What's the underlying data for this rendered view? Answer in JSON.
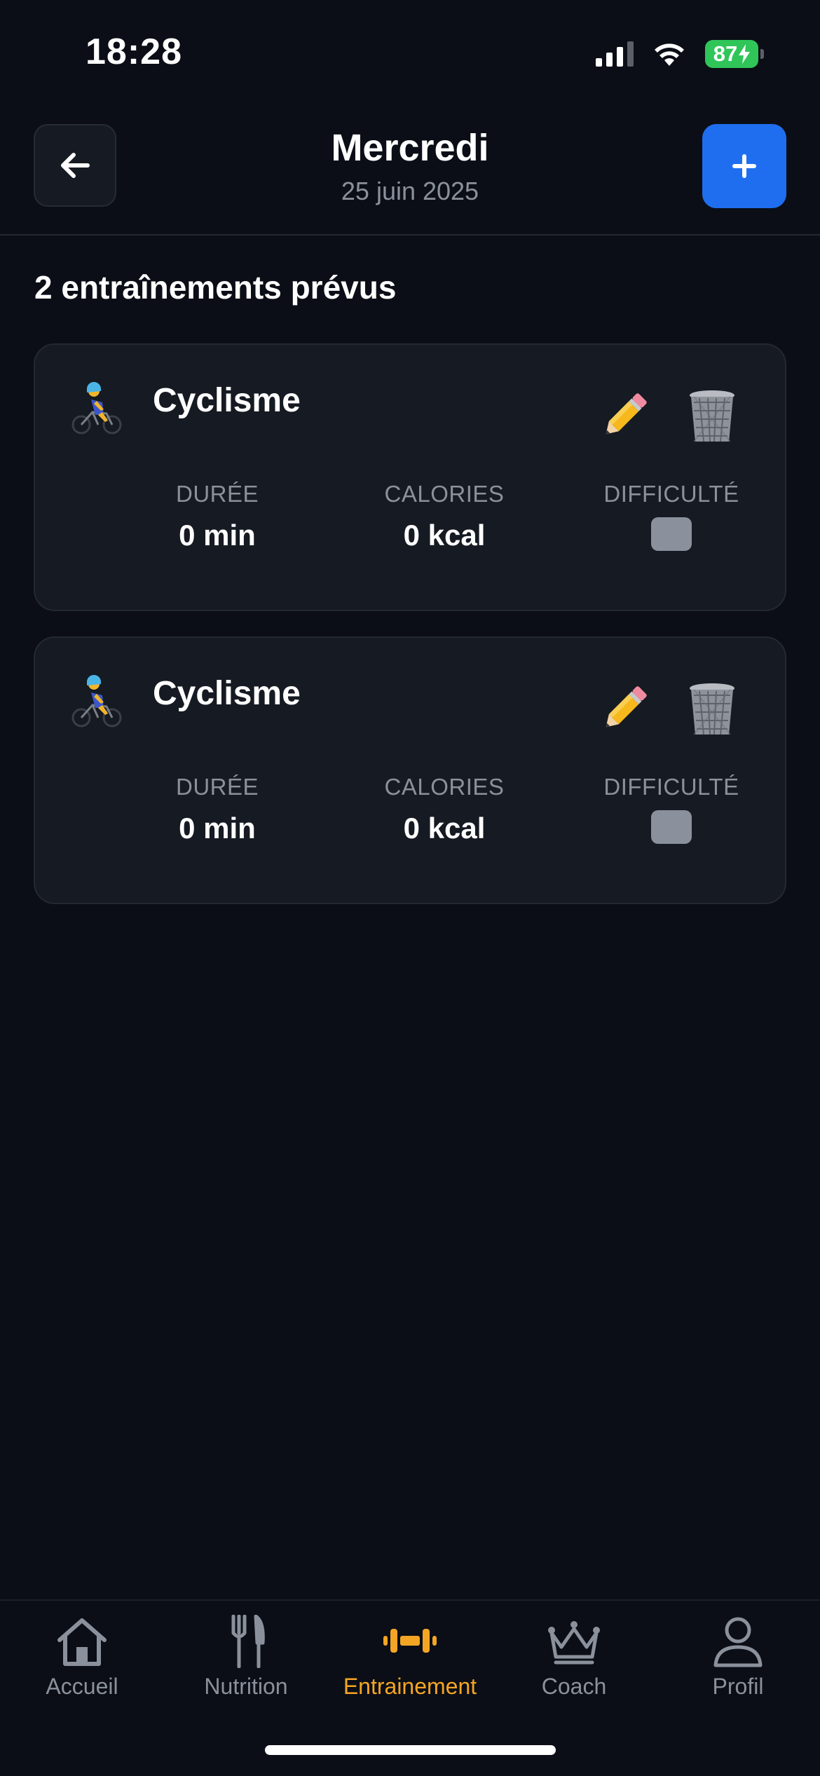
{
  "status_bar": {
    "time": "18:28",
    "battery": "87"
  },
  "header": {
    "title": "Mercredi",
    "subtitle": "25 juin 2025",
    "back_icon": "arrow-left-icon",
    "add_icon": "plus-icon"
  },
  "section": {
    "title": "2 entraînements prévus"
  },
  "workouts": [
    {
      "name": "Cyclisme",
      "icon": "cyclist-icon",
      "stats": [
        {
          "label": "DURÉE",
          "value": "0 min"
        },
        {
          "label": "CALORIES",
          "value": "0 kcal"
        },
        {
          "label": "DIFFICULTÉ",
          "value": ""
        }
      ]
    },
    {
      "name": "Cyclisme",
      "icon": "cyclist-icon",
      "stats": [
        {
          "label": "DURÉE",
          "value": "0 min"
        },
        {
          "label": "CALORIES",
          "value": "0 kcal"
        },
        {
          "label": "DIFFICULTÉ",
          "value": ""
        }
      ]
    }
  ],
  "tab_bar": {
    "active": "Entrainement",
    "tabs": [
      {
        "label": "Accueil",
        "icon": "home-icon"
      },
      {
        "label": "Nutrition",
        "icon": "fork-knife-icon"
      },
      {
        "label": "Entrainement",
        "icon": "dumbbell-icon"
      },
      {
        "label": "Coach",
        "icon": "crown-icon"
      },
      {
        "label": "Profil",
        "icon": "user-icon"
      }
    ]
  },
  "colors": {
    "background": "#0b0e16",
    "card": "#161a22",
    "accent_blue": "#1f6ef0",
    "active_tab": "#f5a524",
    "muted_text": "#8b919c",
    "battery_green": "#30c559"
  }
}
